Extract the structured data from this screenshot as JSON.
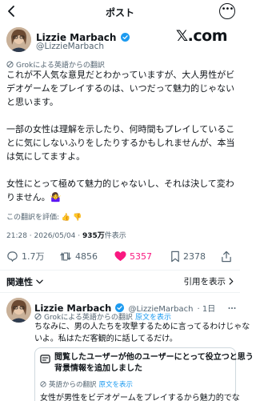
{
  "header": {
    "title": "ポスト",
    "more_glyph": "•••"
  },
  "post": {
    "author_name": "Lizzie Marbach",
    "author_handle": "@LizzieMarbach",
    "brand_mark": "𝕏.com",
    "translation_note": "Grokによる英語からの翻訳",
    "paragraphs": [
      [
        "これが不人気な意見だとわかっていますが、大人男性がビ",
        "デオゲームをプレイするのは、いつだって魅力的じゃない",
        "と思います。"
      ],
      [
        "一部の女性は理解を示したり、何時間もプレイしているこ",
        "とに気にしないふりをしたりするかもしれませんが、本当",
        "は気にしてますよ。"
      ],
      [
        "女性にとって極めて魅力的じゃないし、それは決して変わ",
        "りません。🤷‍♀️"
      ]
    ],
    "rate_translation": "この翻訳を評価: 👍 👎",
    "meta": {
      "time": "21:28 · 2026/05/04 · ",
      "views": "935万",
      "views_suffix": "件表示"
    },
    "stats": {
      "replies": "1.7万",
      "reposts": "4856",
      "likes": "5357",
      "bookmarks": "2378"
    }
  },
  "related": {
    "label": "関連性",
    "show_quotes": "引用を表示"
  },
  "reply": {
    "author_name": "Lizzie Marbach",
    "author_handle": "@LizzieMarbach",
    "time_ago": "· 1日",
    "translation_note": "Grokによる英語からの翻訳",
    "show_original": "原文を表示",
    "lines": [
      "ちなみに、男の人たちを攻撃するために言ってるわけじゃな",
      "いよ。私はただ客観的に話してるだけ。"
    ],
    "community_note": {
      "heading": [
        "閲覧したユーザーが他のユーザーにとって役立つと思う",
        "背景情報を追加しました"
      ],
      "translation_note": "英語からの翻訳",
      "show_original": "原文を表示",
      "text": "女性が男性をビデオゲームをプレイするから魅力的でな"
    }
  },
  "colors": {
    "like": "#f91880",
    "link": "#1d9bf0",
    "verified": "#1d9bf0",
    "muted": "#536471"
  }
}
